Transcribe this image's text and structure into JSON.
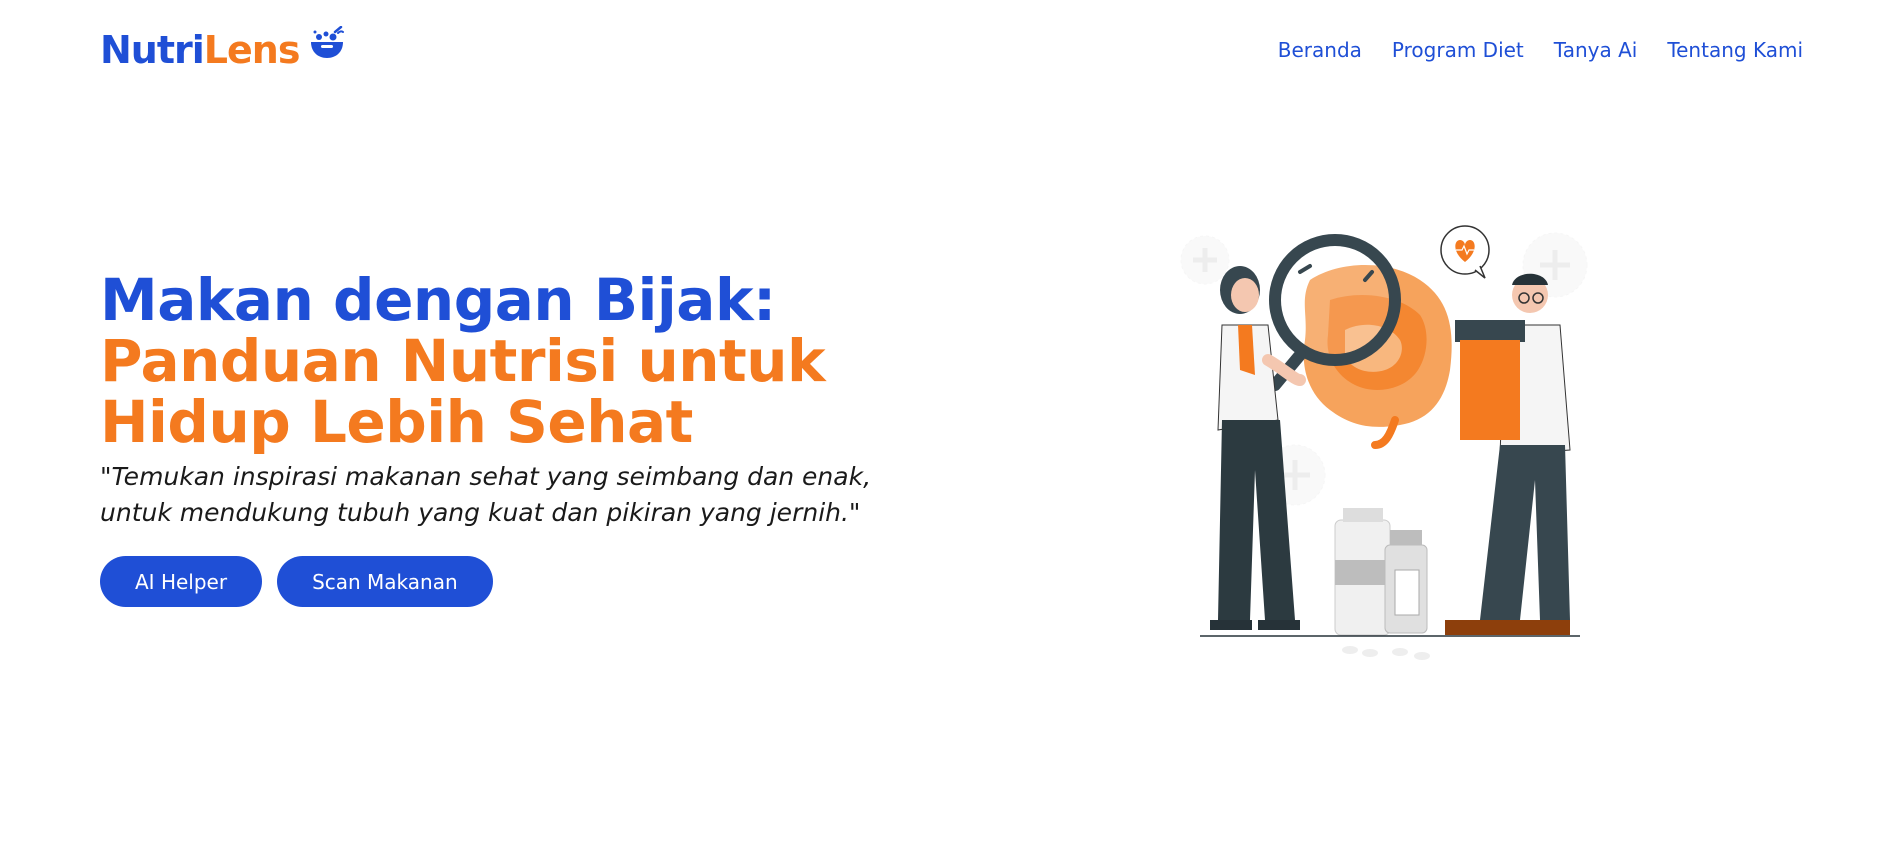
{
  "brand": {
    "name_part1": "Nutri",
    "name_part2": "Lens",
    "icon": "salad-bowl-icon"
  },
  "nav": {
    "items": [
      {
        "label": "Beranda"
      },
      {
        "label": "Program Diet"
      },
      {
        "label": "Tanya Ai"
      },
      {
        "label": "Tentang Kami"
      }
    ]
  },
  "hero": {
    "title_line1": "Makan dengan Bijak:",
    "title_line2": "Panduan Nutrisi untuk",
    "title_line3": "Hidup Lebih Sehat",
    "tagline": "\"Temukan inspirasi makanan sehat yang seimbang dan enak, untuk mendukung tubuh yang kuat dan pikiran yang jernih.\"",
    "buttons": [
      {
        "label": "AI Helper"
      },
      {
        "label": "Scan Makanan"
      }
    ]
  },
  "colors": {
    "primary_blue": "#1f4fd6",
    "accent_orange": "#f47a1f",
    "text_dark": "#1a1a1a",
    "background": "#ffffff"
  },
  "illustration": {
    "icon": "doctors-examining-digestive-system-illustration"
  }
}
